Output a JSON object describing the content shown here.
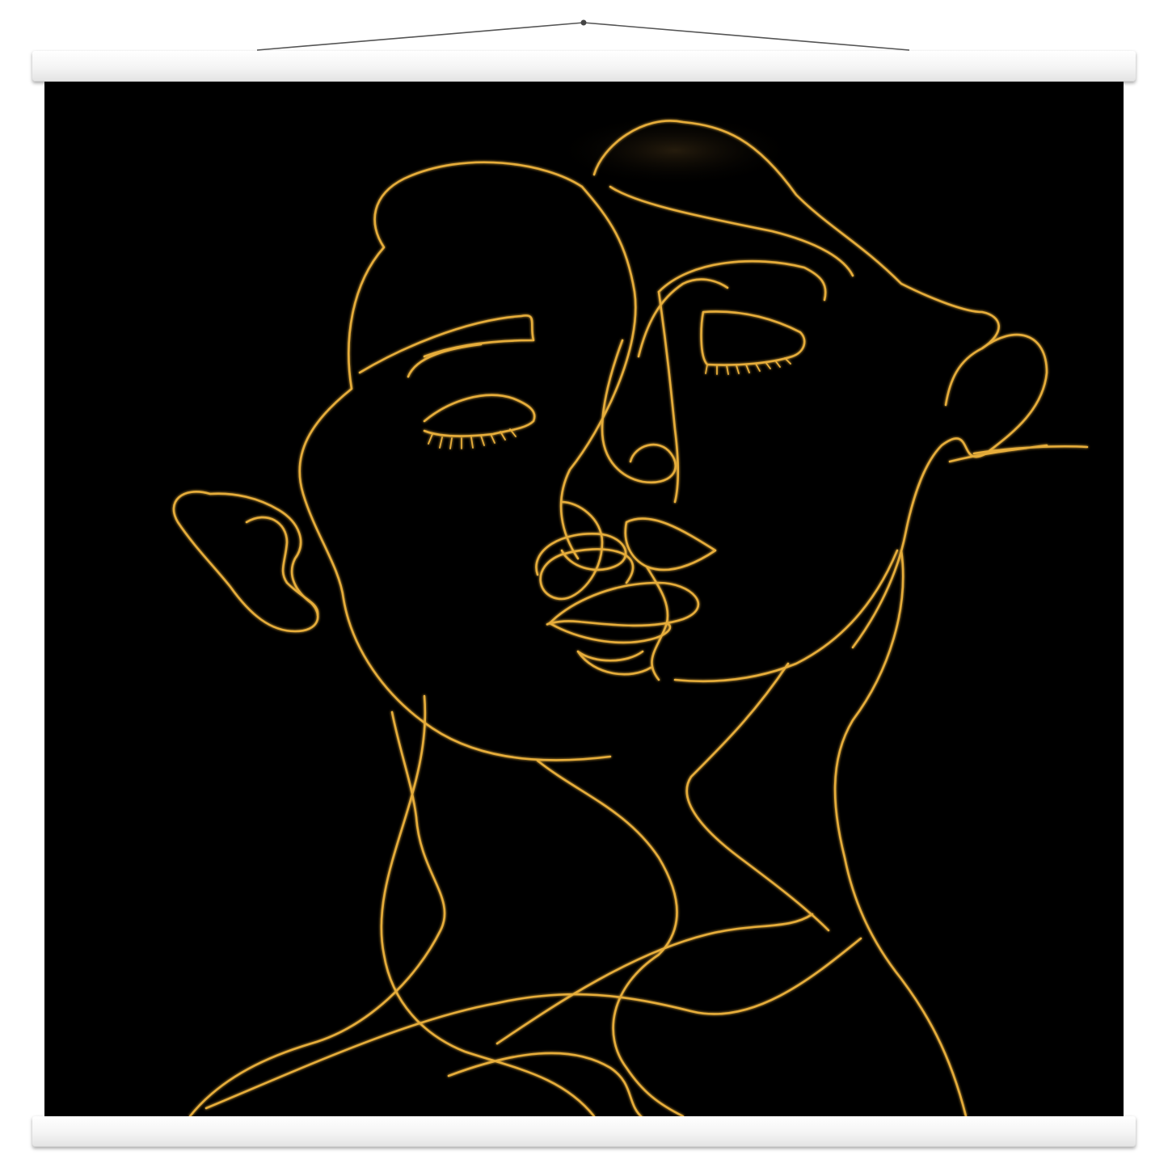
{
  "poster": {
    "subject": "line-art-two-faces",
    "colors": {
      "background": "#000000",
      "line": "#e6ad3a",
      "line_highlight": "#ffd77a",
      "frame": "#ffffff"
    }
  }
}
